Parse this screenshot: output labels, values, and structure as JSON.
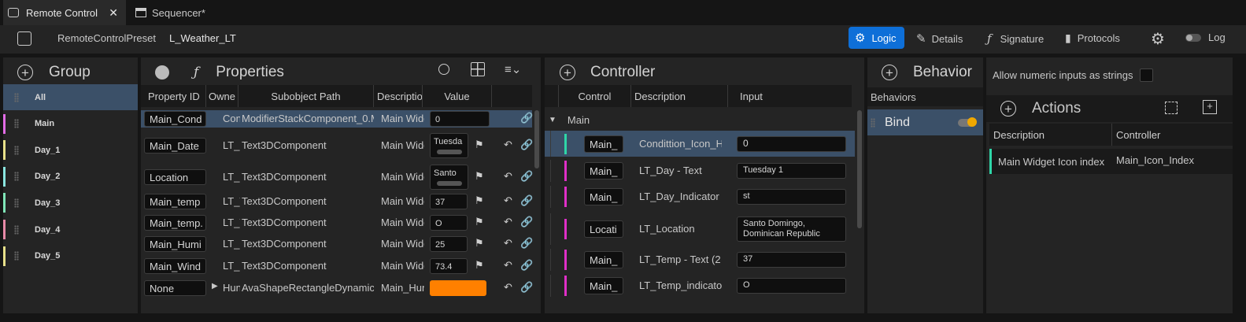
{
  "tabs": [
    {
      "label": "Remote Control",
      "active": true
    },
    {
      "label": "Sequencer*",
      "active": false
    }
  ],
  "toolbar": {
    "preset_label": "RemoteControlPreset",
    "preset_name": "L_Weather_LT",
    "modes": [
      {
        "label": "Logic",
        "active": true
      },
      {
        "label": "Details"
      },
      {
        "label": "Signature"
      },
      {
        "label": "Protocols"
      }
    ],
    "log_label": "Log"
  },
  "group_panel": {
    "title": "Group",
    "items": [
      {
        "label": "All",
        "color": "#00000000",
        "selected": true
      },
      {
        "label": "Main",
        "color": "#e26ce6"
      },
      {
        "label": "Day_1",
        "color": "#e8e08a"
      },
      {
        "label": "Day_2",
        "color": "#8ae6e0"
      },
      {
        "label": "Day_3",
        "color": "#80e6b8"
      },
      {
        "label": "Day_4",
        "color": "#e88aa8"
      },
      {
        "label": "Day_5",
        "color": "#e8e08a"
      }
    ]
  },
  "properties_panel": {
    "title": "Properties",
    "columns": [
      "Property ID",
      "Owne",
      "Subobject Path",
      "Descriptio",
      "Value"
    ],
    "rows": [
      {
        "id": "Main_Cond",
        "owner": "Con",
        "path": "ModifierStackComponent_0.M",
        "desc": "Main Widg",
        "value": "0",
        "type": "text",
        "selected": true
      },
      {
        "id": "Main_Date",
        "owner": "LT_I",
        "path": "Text3DComponent",
        "desc": "Main Widg",
        "value": "Tuesda",
        "type": "multiline"
      },
      {
        "id": "Location",
        "owner": "LT_I",
        "path": "Text3DComponent",
        "desc": "Main Widg",
        "value": "Santo",
        "type": "multiline"
      },
      {
        "id": "Main_temp",
        "owner": "LT_T",
        "path": "Text3DComponent",
        "desc": "Main Widg",
        "value": "37",
        "type": "text"
      },
      {
        "id": "Main_temp.",
        "owner": "LT_T",
        "path": "Text3DComponent",
        "desc": "Main Widg",
        "value": "O",
        "type": "text"
      },
      {
        "id": "Main_Humi",
        "owner": "LT_I",
        "path": "Text3DComponent",
        "desc": "Main Widg",
        "value": "25",
        "type": "text"
      },
      {
        "id": "Main_Wind",
        "owner": "LT_I",
        "path": "Text3DComponent",
        "desc": "Main Widg",
        "value": "73.4",
        "type": "text"
      },
      {
        "id": "None",
        "owner": "Hun",
        "path": "AvaShapeRectangleDynamicM",
        "desc": "Main_Hun",
        "value": "",
        "type": "color",
        "color": "#ff8000"
      }
    ]
  },
  "controller_panel": {
    "title": "Controller",
    "columns": [
      "Control",
      "Description",
      "Input"
    ],
    "group": "Main",
    "rows": [
      {
        "control": "Main_",
        "desc": "Condittion_Icon_Ho",
        "input": "0",
        "color": "#2fd6a8",
        "selected": true
      },
      {
        "control": "Main_",
        "desc": "LT_Day - Text",
        "input": "Tuesday 1",
        "color": "#e02fc8"
      },
      {
        "control": "Main_",
        "desc": "LT_Day_Indicator -",
        "input": "st",
        "color": "#e02fc8"
      },
      {
        "control": "Locati",
        "desc": "LT_Location",
        "input": "Santo Domingo,\nDominican Republic",
        "color": "#e02fc8"
      },
      {
        "control": "Main_",
        "desc": "LT_Temp - Text (2",
        "input": "37",
        "color": "#e02fc8"
      },
      {
        "control": "Main_",
        "desc": "LT_Temp_indicato",
        "input": "O",
        "color": "#e02fc8"
      }
    ]
  },
  "behavior_panel": {
    "title": "Behavior",
    "section": "Behaviors",
    "items": [
      {
        "label": "Bind",
        "enabled": true
      }
    ]
  },
  "details_panel": {
    "allow_numeric_label": "Allow numeric inputs as strings",
    "actions_title": "Actions",
    "columns": [
      "Description",
      "Controller"
    ],
    "rows": [
      {
        "description": "Main Widget Icon index",
        "controller": "Main_Icon_Index",
        "color": "#2fd6a8"
      }
    ]
  }
}
